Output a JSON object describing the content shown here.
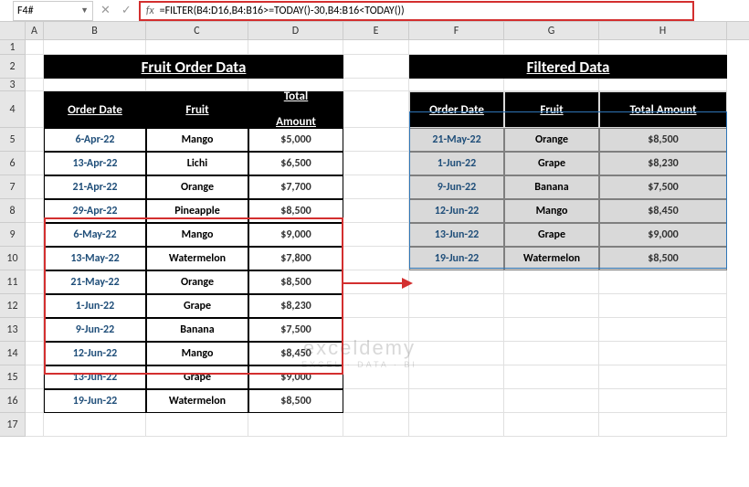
{
  "nameBox": "F4#",
  "formula": "=FILTER(B4:D16,B4:B16>=TODAY()-30,B4:B16<TODAY())",
  "columns": [
    "A",
    "B",
    "C",
    "D",
    "E",
    "F",
    "G",
    "H"
  ],
  "rowNums": [
    "1",
    "2",
    "3",
    "4",
    "5",
    "6",
    "7",
    "8",
    "9",
    "10",
    "11",
    "12",
    "13",
    "14",
    "15",
    "16",
    "17"
  ],
  "titles": {
    "left": "Fruit Order Data",
    "right": "Filtered Data"
  },
  "headers": {
    "orderDate": "Order Date",
    "fruit": "Fruit",
    "totalAmount": "Total Amount",
    "totalAmountShort": "Total Amount"
  },
  "chart_data": {
    "type": "table",
    "left": {
      "columns": [
        "Order Date",
        "Fruit",
        "Total Amount"
      ],
      "rows": [
        [
          "6-Apr-22",
          "Mango",
          "$5,000"
        ],
        [
          "13-Apr-22",
          "Lichi",
          "$6,500"
        ],
        [
          "21-Apr-22",
          "Orange",
          "$7,700"
        ],
        [
          "29-Apr-22",
          "Pineapple",
          "$8,500"
        ],
        [
          "6-May-22",
          "Mango",
          "$9,000"
        ],
        [
          "13-May-22",
          "Watermelon",
          "$7,800"
        ],
        [
          "21-May-22",
          "Orange",
          "$8,500"
        ],
        [
          "1-Jun-22",
          "Grape",
          "$8,230"
        ],
        [
          "9-Jun-22",
          "Banana",
          "$7,500"
        ],
        [
          "12-Jun-22",
          "Mango",
          "$8,450"
        ],
        [
          "13-Jun-22",
          "Grape",
          "$9,000"
        ],
        [
          "19-Jun-22",
          "Watermelon",
          "$8,500"
        ]
      ]
    },
    "right": {
      "columns": [
        "Order Date",
        "Fruit",
        "Total Amount"
      ],
      "rows": [
        [
          "21-May-22",
          "Orange",
          "$8,500"
        ],
        [
          "1-Jun-22",
          "Grape",
          "$8,230"
        ],
        [
          "9-Jun-22",
          "Banana",
          "$7,500"
        ],
        [
          "12-Jun-22",
          "Mango",
          "$8,450"
        ],
        [
          "13-Jun-22",
          "Grape",
          "$9,000"
        ],
        [
          "19-Jun-22",
          "Watermelon",
          "$8,500"
        ]
      ]
    }
  },
  "watermark": {
    "big": "exceldemy",
    "small": "EXCEL · DATA · BI"
  }
}
